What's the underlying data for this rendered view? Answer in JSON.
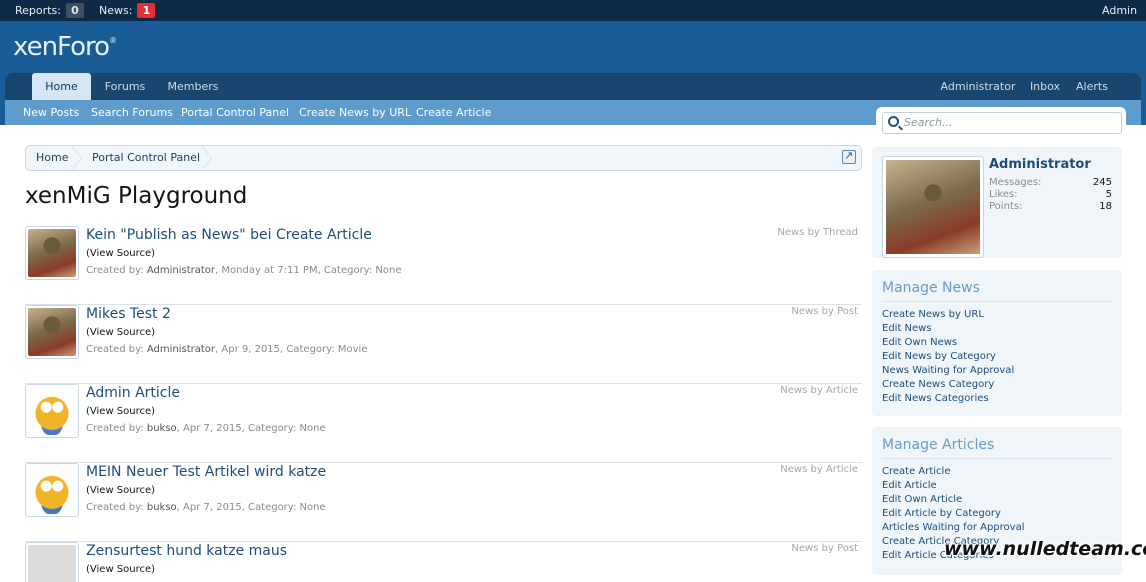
{
  "adminbar": {
    "reports_label": "Reports:",
    "reports_count": "0",
    "news_label": "News:",
    "news_count": "1",
    "admin_link": "Admin"
  },
  "logo": {
    "text": "xenForo",
    "mark": "®"
  },
  "nav": {
    "tabs": [
      {
        "label": "Home"
      },
      {
        "label": "Forums"
      },
      {
        "label": "Members"
      }
    ],
    "right": [
      {
        "label": "Administrator"
      },
      {
        "label": "Inbox"
      },
      {
        "label": "Alerts"
      }
    ],
    "sublinks": [
      {
        "label": "New Posts"
      },
      {
        "label": "Search Forums"
      },
      {
        "label": "Portal Control Panel"
      },
      {
        "label": "Create News by URL"
      },
      {
        "label": "Create Article"
      }
    ]
  },
  "search": {
    "placeholder": "Search..."
  },
  "breadcrumb": [
    {
      "label": "Home"
    },
    {
      "label": "Portal Control Panel"
    }
  ],
  "page_title": "xenMiG Playground",
  "news": [
    {
      "title": "Kein \"Publish as News\" bei Create Article",
      "source": "(View Source)",
      "created_by": "Created by:",
      "user": "Administrator",
      "rest": ", Monday at 7:11 PM, Category: None",
      "type": "News by Thread",
      "avatar": "goblin-avatar"
    },
    {
      "title": "Mikes Test 2",
      "source": "(View Source)",
      "created_by": "Created by:",
      "user": "Administrator",
      "rest": ", Apr 9, 2015, Category: Movie",
      "type": "News by Post",
      "avatar": "goblin-avatar"
    },
    {
      "title": "Admin Article",
      "source": "(View Source)",
      "created_by": "Created by:",
      "user": "bukso",
      "rest": ", Apr 7, 2015, Category: None",
      "type": "News by Article",
      "avatar": "owl-avatar"
    },
    {
      "title": "MEIN Neuer Test Artikel wird katze",
      "source": "(View Source)",
      "created_by": "Created by:",
      "user": "bukso",
      "rest": ", Apr 7, 2015, Category: None",
      "type": "News by Article",
      "avatar": "owl-avatar"
    },
    {
      "title": "Zensurtest hund katze maus",
      "source": "(View Source)",
      "type": "News by Post",
      "avatar": "unknown-avatar"
    }
  ],
  "visitor": {
    "name": "Administrator",
    "stats": [
      {
        "label": "Messages:",
        "value": "245"
      },
      {
        "label": "Likes:",
        "value": "5"
      },
      {
        "label": "Points:",
        "value": "18"
      }
    ]
  },
  "manage_news": {
    "title": "Manage News",
    "links": [
      "Create News by URL",
      "Edit News",
      "Edit Own News",
      "Edit News by Category",
      "News Waiting for Approval",
      "Create News Category",
      "Edit News Categories"
    ]
  },
  "manage_articles": {
    "title": "Manage Articles",
    "links": [
      "Create Article",
      "Edit Article",
      "Edit Own Article",
      "Edit Article by Category",
      "Articles Waiting for Approval",
      "Create Article Category",
      "Edit Article Categories"
    ]
  },
  "watermark": "www.nulledteam.com",
  "colors": {
    "adminbar_bg": "#0f2a46",
    "header_bg": "#1a5c95",
    "nav_bg": "#19466f",
    "subnav_bg": "#5e9ccd",
    "link": "#1e4d78",
    "alert_badge": "#e03030"
  }
}
